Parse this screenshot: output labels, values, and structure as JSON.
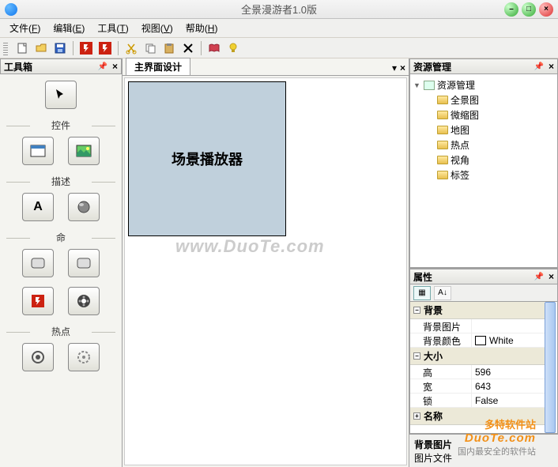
{
  "app": {
    "title": "全景漫游者1.0版"
  },
  "menus": [
    {
      "label": "文件",
      "key": "F"
    },
    {
      "label": "编辑",
      "key": "E"
    },
    {
      "label": "工具",
      "key": "T"
    },
    {
      "label": "视图",
      "key": "V"
    },
    {
      "label": "帮助",
      "key": "H"
    }
  ],
  "toolbox": {
    "title": "工具箱",
    "groups": {
      "controls": "控件",
      "describe": "描述",
      "ming": "命",
      "hotspot": "热点"
    }
  },
  "designer": {
    "tab": "主界面设计",
    "canvas_object_label": "场景播放器",
    "watermark": "www.DuoTe.com"
  },
  "resources": {
    "title": "资源管理",
    "root": "资源管理",
    "items": [
      "全景图",
      "微缩图",
      "地图",
      "热点",
      "视角",
      "标签"
    ]
  },
  "properties": {
    "title": "属性",
    "categories": [
      {
        "name": "背景",
        "rows": [
          {
            "key": "背景图片",
            "value": ""
          },
          {
            "key": "背景颜色",
            "value": "White",
            "color": "#ffffff"
          }
        ]
      },
      {
        "name": "大小",
        "rows": [
          {
            "key": "高",
            "value": "596"
          },
          {
            "key": "宽",
            "value": "643"
          },
          {
            "key": "锁",
            "value": "False"
          }
        ]
      },
      {
        "name": "名称",
        "rows": []
      }
    ],
    "description": {
      "header": "背景图片",
      "body": "图片文件"
    }
  },
  "footer": {
    "brand_cn": "多特软件站",
    "brand_en": "DuoTe.com",
    "slogan": "国内最安全的软件站"
  },
  "chart_data": null
}
